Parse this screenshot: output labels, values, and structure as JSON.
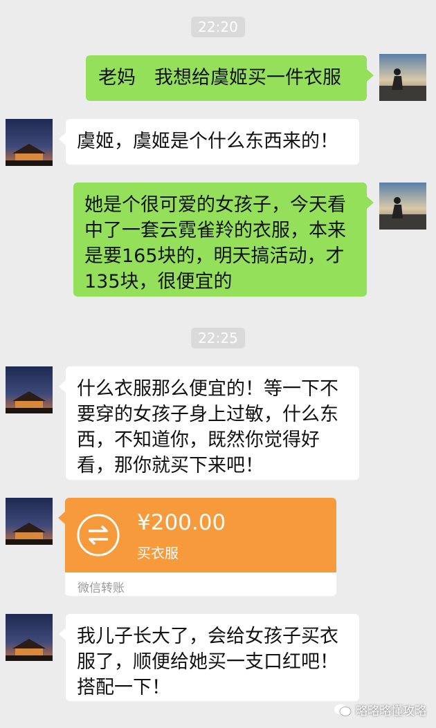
{
  "timestamps": [
    "22:20",
    "22:25"
  ],
  "messages": [
    {
      "side": "right",
      "text": "老妈　我想给虞姬买一件衣服"
    },
    {
      "side": "left",
      "text": "虞姬，虞姬是个什么东西来的！"
    },
    {
      "side": "right",
      "text": "她是个很可爱的女孩子，今天看中了一套云霓雀羚的衣服，本来是要165块的，明天搞活动，才135块，很便宜的"
    },
    {
      "side": "left",
      "text": "什么衣服那么便宜的！等一下不要穿的女孩子身上过敏，什么东西，不知道你，既然你觉得好看，那你就买下来吧！"
    },
    {
      "side": "left",
      "text": "我儿子长大了，会给女孩子买衣服了，顺便给她买一支口红吧！搭配一下！"
    }
  ],
  "transfer": {
    "amount": "¥200.00",
    "memo": "买衣服",
    "service": "微信转账",
    "icon": "transfer-arrows-icon",
    "color": "#f79a3c"
  },
  "watermark": "略略略懂攻略",
  "colors": {
    "right_bubble": "#95e05a",
    "left_bubble": "#ffffff",
    "background": "#ececec"
  }
}
